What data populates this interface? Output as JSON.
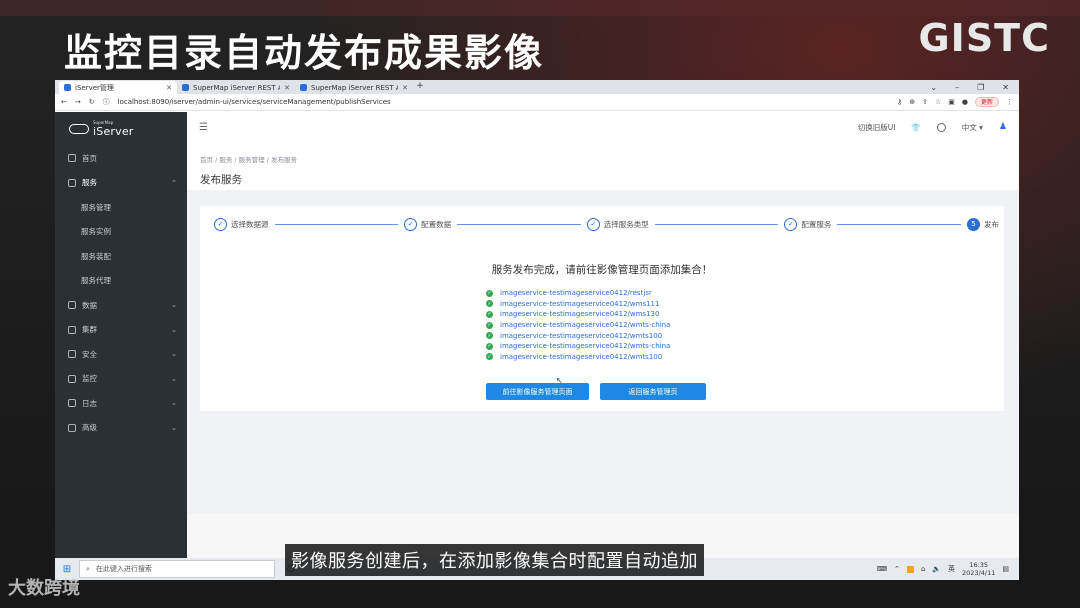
{
  "video": {
    "title": "监控目录自动发布成果影像",
    "brand": "GISTC",
    "subtitle": "影像服务创建后，在添加影像集合时配置自动追加",
    "watermark": "大数跨境"
  },
  "browser": {
    "tabs": [
      {
        "label": "iServer管理",
        "active": true
      },
      {
        "label": "SuperMap iServer REST API",
        "active": false
      },
      {
        "label": "SuperMap iServer REST API",
        "active": false
      }
    ],
    "url": "localhost:8090/iserver/admin-ui/services/serviceManagement/publishServices",
    "update_label": "更新"
  },
  "sidebar": {
    "logo_small": "SuperMap",
    "logo": "iServer",
    "items": [
      {
        "label": "首页",
        "icon": "home-icon"
      },
      {
        "label": "服务",
        "icon": "eye-icon",
        "open": true
      },
      {
        "label": "服务管理",
        "sub": true
      },
      {
        "label": "服务实例",
        "sub": true
      },
      {
        "label": "服务装配",
        "sub": true
      },
      {
        "label": "服务代理",
        "sub": true
      },
      {
        "label": "数据",
        "icon": "database-icon"
      },
      {
        "label": "集群",
        "icon": "cluster-icon"
      },
      {
        "label": "安全",
        "icon": "shield-icon"
      },
      {
        "label": "监控",
        "icon": "monitor-icon"
      },
      {
        "label": "日志",
        "icon": "log-icon"
      },
      {
        "label": "高级",
        "icon": "advanced-icon"
      }
    ]
  },
  "topbar": {
    "switch_ui": "切换旧版UI",
    "language": "中文"
  },
  "page": {
    "breadcrumb": "首页  /  服务  /  服务管理  /  发布服务",
    "title": "发布服务"
  },
  "steps": [
    {
      "label": "选择数据源",
      "done": true
    },
    {
      "label": "配置数据",
      "done": true
    },
    {
      "label": "选择服务类型",
      "done": true
    },
    {
      "label": "配置服务",
      "done": true
    },
    {
      "label": "发布",
      "done": false,
      "number": "5"
    }
  ],
  "result": {
    "message": "服务发布完成，请前往影像管理页面添加集合！",
    "links": [
      "imageservice-testimageservice0412/restjsr",
      "imageservice-testimageservice0412/wms111",
      "imageservice-testimageservice0412/wms130",
      "imageservice-testimageservice0412/wmts-china",
      "imageservice-testimageservice0412/wmts100",
      "imageservice-testimageservice0412/wmts-china",
      "imageservice-testimageservice0412/wmts100"
    ],
    "goto_button": "前往影像服务管理页面",
    "back_button": "返回服务管理页"
  },
  "taskbar": {
    "search_placeholder": "在此键入进行搜索",
    "ime": "英",
    "time": "16:35",
    "date": "2023/4/11"
  }
}
